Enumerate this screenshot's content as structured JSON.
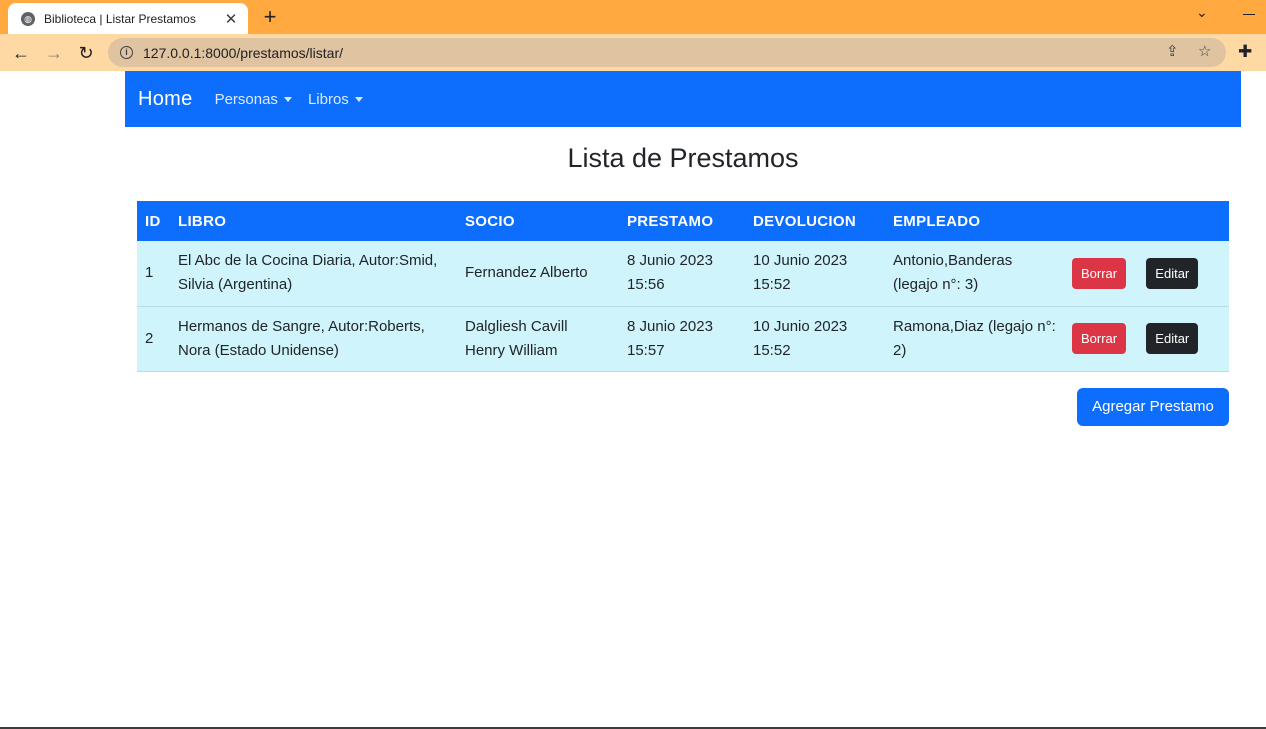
{
  "browser": {
    "tab_title": "Biblioteca | Listar Prestamos",
    "tab_close": "✕",
    "new_tab": "+",
    "url": "127.0.0.1:8000/prestamos/listar/"
  },
  "navbar": {
    "brand": "Home",
    "items": [
      {
        "label": "Personas"
      },
      {
        "label": "Libros"
      }
    ]
  },
  "page": {
    "title": "Lista de Prestamos",
    "add_button": "Agregar Prestamo"
  },
  "table": {
    "headers": {
      "id": "ID",
      "libro": "LIBRO",
      "socio": "SOCIO",
      "prestamo": "PRESTAMO",
      "devolucion": "DEVOLUCION",
      "empleado": "EMPLEADO"
    },
    "rows": [
      {
        "id": "1",
        "libro": "El Abc de la Cocina Diaria, Autor:Smid, Silvia (Argentina)",
        "socio": "Fernandez Alberto",
        "prestamo": "8 Junio 2023 15:56",
        "devolucion": "10 Junio 2023 15:52",
        "empleado": "Antonio,Banderas (legajo n°: 3)",
        "delete_label": "Borrar",
        "edit_label": "Editar"
      },
      {
        "id": "2",
        "libro": "Hermanos de Sangre, Autor:Roberts, Nora (Estado Unidense)",
        "socio": "Dalgliesh Cavill Henry William",
        "prestamo": "8 Junio 2023 15:57",
        "devolucion": "10 Junio 2023 15:52",
        "empleado": "Ramona,Diaz (legajo n°: 2)",
        "delete_label": "Borrar",
        "edit_label": "Editar"
      }
    ]
  },
  "colors": {
    "primary": "#0d6efd",
    "danger": "#dc3545",
    "dark": "#212529",
    "row_bg": "#cff4fc",
    "tabstrip": "#ffa940",
    "toolbar": "#ffd9a3"
  }
}
